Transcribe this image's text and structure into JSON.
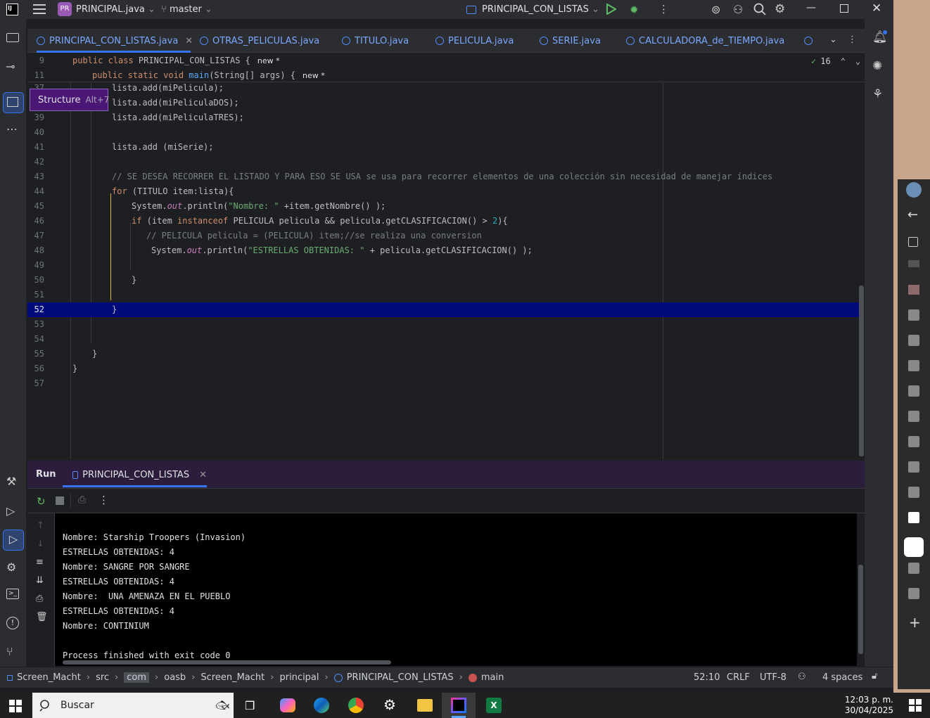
{
  "titlebar": {
    "project_badge": "PR",
    "project_name": "PRINCIPAL.java",
    "branch": "master",
    "run_config": "PRINCIPAL_CON_LISTAS"
  },
  "tabs": [
    {
      "label": "PRINCIPAL_CON_LISTAS.java",
      "active": true
    },
    {
      "label": "OTRAS_PELICULAS.java"
    },
    {
      "label": "TITULO.java"
    },
    {
      "label": "PELICULA.java"
    },
    {
      "label": "SERIE.java"
    },
    {
      "label": "CALCULADORA_de_TIEMPO.java"
    }
  ],
  "tooltip": {
    "label": "Structure",
    "shortcut": "Alt+7"
  },
  "editor": {
    "warnings_count": "16",
    "sticky": [
      {
        "ln": "9",
        "pre": "public class ",
        "name": "PRINCIPAL_CON_LISTAS",
        "post": " {",
        "badge": "new *"
      },
      {
        "ln": "11",
        "pre": "public static void ",
        "name": "main",
        "post": "(String[] args) {",
        "badge": "new *"
      }
    ],
    "lines": [
      {
        "ln": "37",
        "text": "lista.add(miPelicula);"
      },
      {
        "ln": "38",
        "text": "lista.add(miPeliculaDOS);"
      },
      {
        "ln": "39",
        "text": "lista.add(miPeliculaTRES);"
      },
      {
        "ln": "40",
        "text": ""
      },
      {
        "ln": "41",
        "text": "lista.add (miSerie);"
      },
      {
        "ln": "42",
        "text": ""
      },
      {
        "ln": "43",
        "text": "// SE DESEA RECORRER EL LISTADO Y PARA ESO SE USA se usa para recorrer elementos de una colección sin necesidad de manejar índices"
      },
      {
        "ln": "44",
        "text": "for (TITULO item:lista){"
      },
      {
        "ln": "45",
        "text": "System.out.println(\"Nombre: \" +item.getNombre() );"
      },
      {
        "ln": "46",
        "text": "if (item instanceof PELICULA pelicula && pelicula.getCLASIFICACION() > 2){"
      },
      {
        "ln": "47",
        "text": "// PELICULA pelicula = (PELICULA) item;//se realiza una conversion"
      },
      {
        "ln": "48",
        "text": "System.out.println(\"ESTRELLAS OBTENIDAS: \" + pelicula.getCLASIFICACION() );"
      },
      {
        "ln": "49",
        "text": ""
      },
      {
        "ln": "50",
        "text": "}"
      },
      {
        "ln": "51",
        "text": ""
      },
      {
        "ln": "52",
        "text": "}"
      },
      {
        "ln": "53",
        "text": ""
      },
      {
        "ln": "54",
        "text": ""
      },
      {
        "ln": "55",
        "text": "}"
      },
      {
        "ln": "56",
        "text": "}"
      },
      {
        "ln": "57",
        "text": ""
      }
    ],
    "current_line": "52"
  },
  "run": {
    "title": "Run",
    "tab_label": "PRINCIPAL_CON_LISTAS",
    "output": [
      "Nombre: Starship Troopers (Invasion)",
      "ESTRELLAS OBTENIDAS: 4",
      "Nombre: SANGRE POR SANGRE",
      "ESTRELLAS OBTENIDAS: 4",
      "Nombre:  UNA AMENAZA EN EL PUEBLO",
      "ESTRELLAS OBTENIDAS: 4",
      "Nombre: CONTINIUM",
      "",
      "Process finished with exit code 0"
    ]
  },
  "statusbar": {
    "breadcrumbs": [
      "Screen_Macht",
      "src",
      "com",
      "oasb",
      "Screen_Macht",
      "principal",
      "PRINCIPAL_CON_LISTAS",
      "main"
    ],
    "position": "52:10",
    "line_sep": "CRLF",
    "encoding": "UTF-8",
    "indent": "4 spaces"
  },
  "taskbar": {
    "search_placeholder": "Buscar",
    "time": "12:03 p. m.",
    "date": "30/04/2025"
  },
  "colors": {
    "accent": "#3574f0",
    "selected_line": "#000a7a",
    "run_header": "#2b1d3b"
  }
}
